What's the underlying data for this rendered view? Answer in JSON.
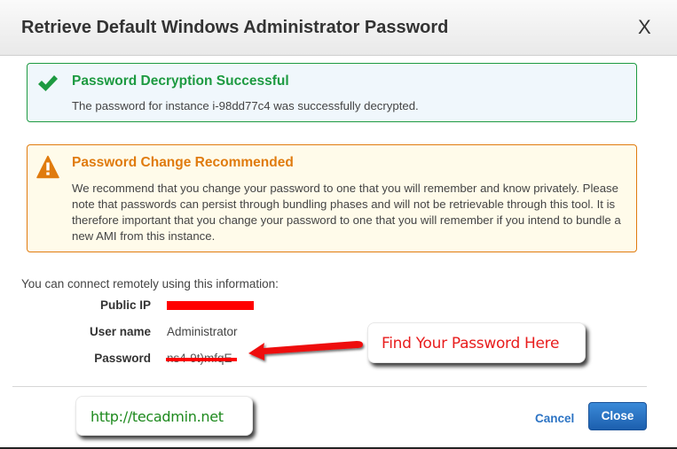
{
  "dialog": {
    "title": "Retrieve Default Windows Administrator Password",
    "close_glyph": "X"
  },
  "success_alert": {
    "icon": "checkmark-icon",
    "title": "Password Decryption Successful",
    "body": "The password for instance i-98dd77c4 was successfully decrypted.",
    "color": "#1d9a41"
  },
  "warning_alert": {
    "icon": "warning-triangle-icon",
    "title": "Password Change Recommended",
    "body": "We recommend that you change your password to one that you will remember and know privately. Please note that passwords can persist through bundling phases and will not be retrievable through this tool. It is therefore important that you change your password to one that you will remember if you intend to bundle a new AMI from this instance.",
    "color": "#e07b0e"
  },
  "connection": {
    "intro": "You can connect remotely using this information:",
    "rows": [
      {
        "label": "Public IP",
        "value": "",
        "redacted": true
      },
      {
        "label": "User name",
        "value": "Administrator"
      },
      {
        "label": "Password",
        "value": "ns4-9t)mfqE",
        "struck_out": true
      }
    ]
  },
  "annotations": {
    "find_password": "Find Your Password Here",
    "website": "http://tecadmin.net"
  },
  "footer": {
    "cancel_label": "Cancel",
    "close_label": "Close"
  }
}
